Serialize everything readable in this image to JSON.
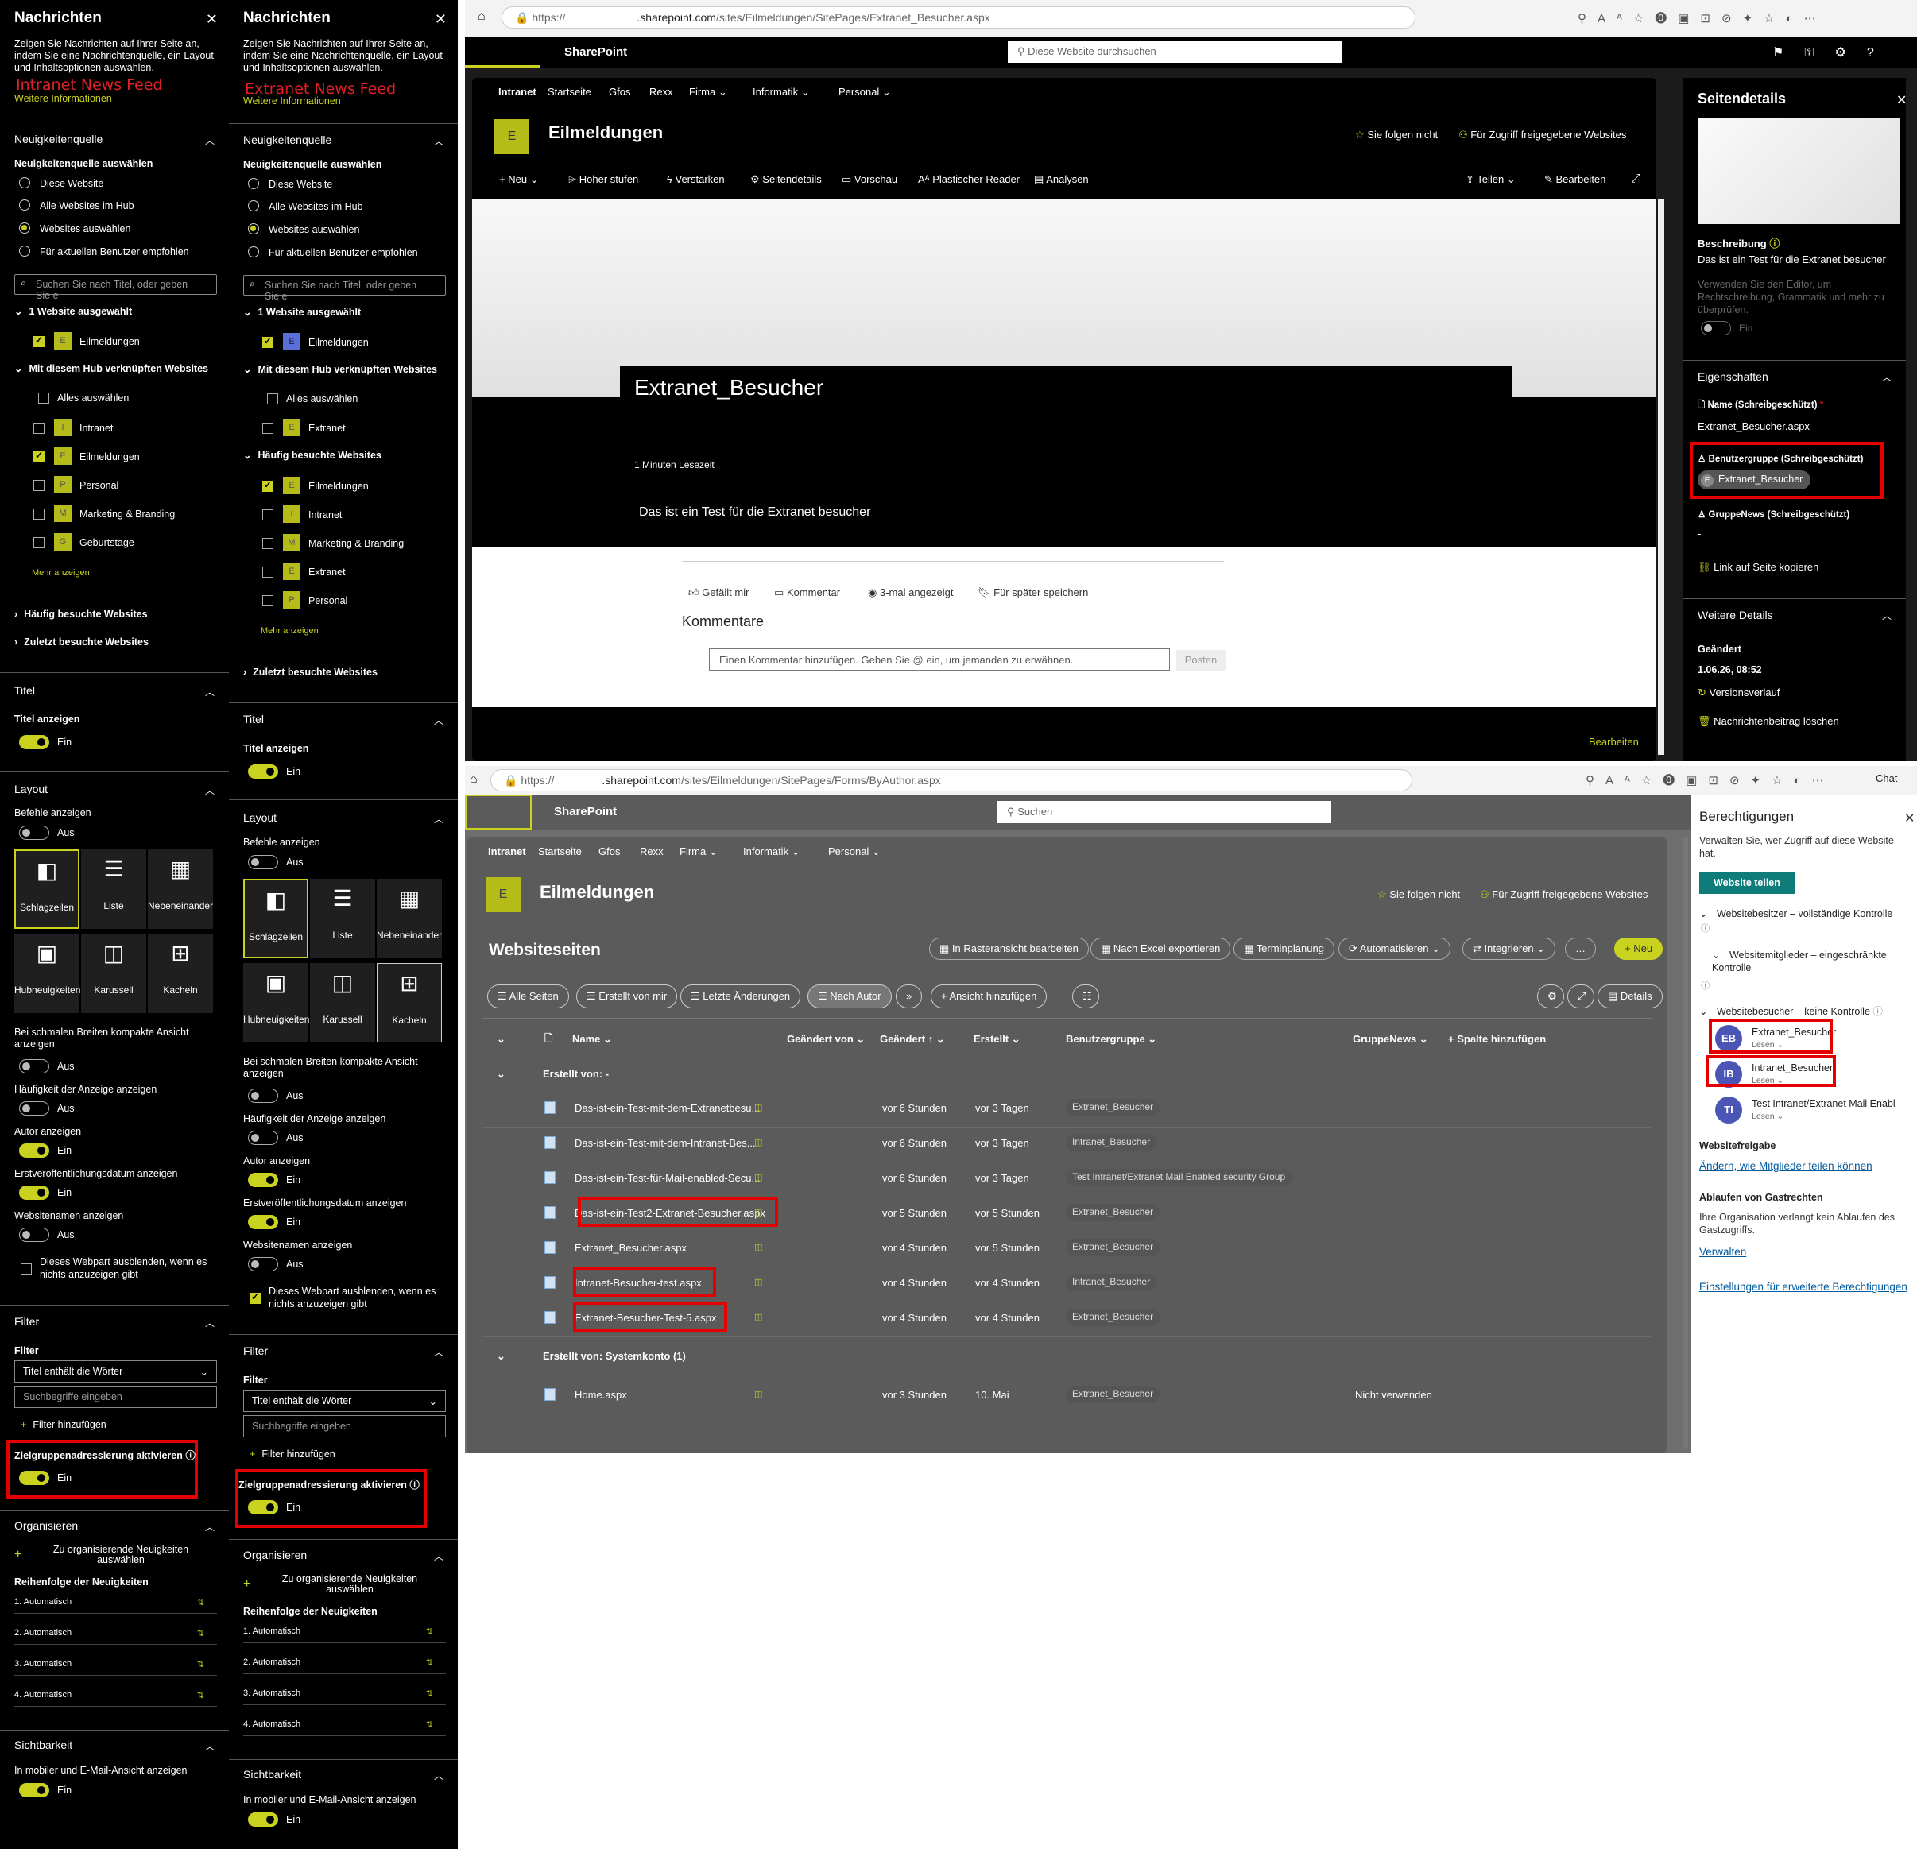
{
  "left_panes": [
    {
      "title": "Nachrichten",
      "description": "Zeigen Sie Nachrichten auf Ihrer Seite an, indem Sie eine Nachrichtenquelle, ein Layout und Inhaltsoptionen auswählen.",
      "annotation": "Intranet News Feed",
      "more_info": "Weitere Informationen",
      "source_section": "Neuigkeitenquelle",
      "source_label": "Neuigkeitenquelle auswählen",
      "radios": [
        "Diese Website",
        "Alle Websites im Hub",
        "Websites auswählen",
        "Für aktuellen Benutzer empfohlen"
      ],
      "search_placeholder": "Suchen Sie nach Titel, oder geben Sie e",
      "selected_header": "1 Website ausgewählt",
      "selected_site": "Eilmeldungen",
      "hub_header": "Mit diesem Hub verknüpften Websites",
      "select_all": "Alles auswählen",
      "hub_sites": [
        {
          "letter": "I",
          "name": "Intranet",
          "checked": false
        },
        {
          "letter": "E",
          "name": "Eilmeldungen",
          "checked": true
        },
        {
          "letter": "P",
          "name": "Personal",
          "checked": false
        },
        {
          "letter": "M",
          "name": "Marketing & Branding",
          "checked": false
        },
        {
          "letter": "G",
          "name": "Geburtstage",
          "checked": false
        }
      ],
      "more": "Mehr anzeigen",
      "frequent": "Häufig besuchte Websites",
      "recent": "Zuletzt besuchte Websites"
    },
    {
      "title": "Nachrichten",
      "description": "Zeigen Sie Nachrichten auf Ihrer Seite an, indem Sie eine Nachrichtenquelle, ein Layout und Inhaltsoptionen auswählen.",
      "annotation": "Extranet News Feed",
      "more_info": "Weitere Informationen",
      "source_section": "Neuigkeitenquelle",
      "source_label": "Neuigkeitenquelle auswählen",
      "radios": [
        "Diese Website",
        "Alle Websites im Hub",
        "Websites auswählen",
        "Für aktuellen Benutzer empfohlen"
      ],
      "search_placeholder": "Suchen Sie nach Titel, oder geben Sie e",
      "selected_header": "1 Website ausgewählt",
      "selected_site": "Eilmeldungen",
      "hub_header": "Mit diesem Hub verknüpften Websites",
      "select_all": "Alles auswählen",
      "hub_sites": [
        {
          "letter": "E",
          "name": "Extranet",
          "checked": false
        }
      ],
      "frequent": "Häufig besuchte Websites",
      "frequent_sites": [
        {
          "letter": "E",
          "name": "Eilmeldungen",
          "checked": true
        },
        {
          "letter": "I",
          "name": "Intranet",
          "checked": false
        },
        {
          "letter": "M",
          "name": "Marketing & Branding",
          "checked": false
        },
        {
          "letter": "E",
          "name": "Extranet",
          "checked": false
        },
        {
          "letter": "P",
          "name": "Personal",
          "checked": false
        }
      ],
      "more": "Mehr anzeigen",
      "recent": "Zuletzt besuchte Websites"
    }
  ],
  "pane_common": {
    "title_section": "Titel",
    "show_title": "Titel anzeigen",
    "on": "Ein",
    "off": "Aus",
    "layout_section": "Layout",
    "show_commands": "Befehle anzeigen",
    "tiles": [
      "Schlagzeilen",
      "Liste",
      "Nebeneinander",
      "Hubneuigkeiten",
      "Karussell",
      "Kacheln"
    ],
    "compact": "Bei schmalen Breiten kompakte Ansicht anzeigen",
    "views": "Häufigkeit der Anzeige anzeigen",
    "author": "Autor anzeigen",
    "first_pub": "Erstveröffentlichungsdatum anzeigen",
    "site_names": "Websitenamen anzeigen",
    "hide_webpart": "Dieses Webpart ausblenden, wenn es nichts anzuzeigen gibt",
    "filter_section": "Filter",
    "filter_label": "Filter",
    "filter_dropdown": "Titel enthält die Wörter",
    "filter_placeholder": "Suchbegriffe eingeben",
    "add_filter": "Filter hinzufügen",
    "audience": "Zielgruppenadressierung aktivieren",
    "organize_section": "Organisieren",
    "organize_pick": "Zu organisierende Neuigkeiten auswählen",
    "order_label": "Reihenfolge der Neuigkeiten",
    "order": [
      "1. Automatisch",
      "2. Automatisch",
      "3. Automatisch",
      "4. Automatisch"
    ],
    "visibility_section": "Sichtbarkeit",
    "mobile_email": "In mobiler und E-Mail-Ansicht anzeigen"
  },
  "browser_top": {
    "url_prefix": "https://",
    "url_main": ".sharepoint.com",
    "url_path": "/sites/Eilmeldungen/SitePages/Extranet_Besucher.aspx",
    "app": "SharePoint",
    "search": "Diese Website durchsuchen",
    "nav": [
      "Intranet",
      "Startseite",
      "Gfos",
      "Rexx",
      "Firma",
      "Informatik",
      "Personal"
    ],
    "site_letter": "E",
    "site_name": "Eilmeldungen",
    "follow": "Sie folgen nicht",
    "shared": "Für Zugriff freigegebene Websites",
    "commands": [
      "Neu",
      "Höher stufen",
      "Verstärken",
      "Seitendetails",
      "Vorschau",
      "Plastischer Reader",
      "Analysen"
    ],
    "share": "Teilen",
    "edit": "Bearbeiten",
    "page_title": "Extranet_Besucher",
    "read_time": "1 Minuten Lesezeit",
    "body_text": "Das ist ein Test für die Extranet besucher",
    "actions": [
      "Gefällt mir",
      "Kommentar",
      "3-mal angezeigt",
      "Für später speichern"
    ],
    "comments": "Kommentare",
    "comment_placeholder": "Einen Kommentar hinzufügen. Geben Sie @ ein, um jemanden zu erwähnen.",
    "post": "Posten",
    "footer_edit": "Bearbeiten",
    "details": {
      "title": "Seitendetails",
      "description_label": "Beschreibung",
      "description": "Das ist ein Test für die Extranet besucher",
      "hint": "Verwenden Sie den Editor, um Rechtschreibung, Grammatik und mehr zu überprüfen.",
      "hint_toggle": "Ein",
      "properties": "Eigenschaften",
      "name_label": "Name (Schreibgeschützt)",
      "name_value": "Extranet_Besucher.aspx",
      "group_label": "Benutzergruppe (Schreibgeschützt)",
      "group_value": "Extranet_Besucher",
      "group_letter": "E",
      "news_label": "GruppeNews (Schreibgeschützt)",
      "news_value": "-",
      "copy_link": "Link auf Seite kopieren",
      "more_details": "Weitere Details",
      "changed_label": "Geändert",
      "changed_value": "1.06.26, 08:52",
      "version_history": "Versionsverlauf",
      "delete": "Nachrichtenbeitrag löschen"
    }
  },
  "browser_bottom": {
    "url_prefix": "https://",
    "url_main": ".sharepoint.com",
    "url_path": "/sites/Eilmeldungen/SitePages/Forms/ByAuthor.aspx",
    "app": "SharePoint",
    "search": "Suchen",
    "chat": "Chat",
    "nav": [
      "Intranet",
      "Startseite",
      "Gfos",
      "Rexx",
      "Firma",
      "Informatik",
      "Personal"
    ],
    "site_letter": "E",
    "site_name": "Eilmeldungen",
    "follow": "Sie folgen nicht",
    "shared": "Für Zugriff freigegebene Websites",
    "lib_title": "Websiteseiten",
    "toolbar": [
      "In Rasteransicht bearbeiten",
      "Nach Excel exportieren",
      "Terminplanung",
      "Automatisieren",
      "Integrieren",
      "…",
      "Neu"
    ],
    "views": [
      "Alle Seiten",
      "Erstellt von mir",
      "Letzte Änderungen",
      "Nach Autor",
      "»",
      "Ansicht hinzufügen"
    ],
    "details_btn": "Details",
    "columns": [
      "Name",
      "Geändert von",
      "Geändert",
      "Erstellt",
      "Benutzergruppe",
      "GruppeNews",
      "Spalte hinzufügen"
    ],
    "group1": "Erstellt von: -",
    "rows1": [
      {
        "name": "Das-ist-ein-Test-mit-dem-Extranetbesu...",
        "changed": "vor 6 Stunden",
        "created": "vor 3 Tagen",
        "group": "Extranet_Besucher",
        "news": ""
      },
      {
        "name": "Das-ist-ein-Test-mit-dem-Intranet-Bes...",
        "changed": "vor 6 Stunden",
        "created": "vor 3 Tagen",
        "group": "Intranet_Besucher",
        "news": ""
      },
      {
        "name": "Das-ist-ein-Test-für-Mail-enabled-Secu...",
        "changed": "vor 6 Stunden",
        "created": "vor 3 Tagen",
        "group": "Test Intranet/Extranet Mail Enabled security Group",
        "news": ""
      },
      {
        "name": "Das-ist-ein-Test2-Extranet-Besucher.aspx",
        "changed": "vor 5 Stunden",
        "created": "vor 5 Stunden",
        "group": "Extranet_Besucher",
        "news": ""
      },
      {
        "name": "Extranet_Besucher.aspx",
        "changed": "vor 4 Stunden",
        "created": "vor 5 Stunden",
        "group": "Extranet_Besucher",
        "news": ""
      },
      {
        "name": "Intranet-Besucher-test.aspx",
        "changed": "vor 4 Stunden",
        "created": "vor 4 Stunden",
        "group": "Intranet_Besucher",
        "news": ""
      },
      {
        "name": "Extranet-Besucher-Test-5.aspx",
        "changed": "vor 4 Stunden",
        "created": "vor 4 Stunden",
        "group": "Extranet_Besucher",
        "news": ""
      }
    ],
    "group2": "Erstellt von: Systemkonto (1)",
    "rows2": [
      {
        "name": "Home.aspx",
        "changed": "vor 3 Stunden",
        "created": "10. Mai",
        "group": "Extranet_Besucher",
        "news": "Nicht verwenden"
      }
    ],
    "permissions": {
      "title": "Berechtigungen",
      "desc": "Verwalten Sie, wer Zugriff auf diese Website hat.",
      "share_btn": "Website teilen",
      "owners": "Websitebesitzer – vollständige Kontrolle",
      "members": "Websitemitglieder – eingeschränkte Kontrolle",
      "visitors": "Websitebesucher – keine Kontrolle",
      "people": [
        {
          "initials": "EB",
          "name": "Extranet_Besucher",
          "role": "Lesen"
        },
        {
          "initials": "IB",
          "name": "Intranet_Besucher",
          "role": "Lesen"
        },
        {
          "initials": "TI",
          "name": "Test Intranet/Extranet Mail Enabl",
          "role": "Lesen"
        }
      ],
      "sharing": "Websitefreigabe",
      "sharing_link": "Ändern, wie Mitglieder teilen können",
      "guest": "Ablaufen von Gastrechten",
      "guest_desc": "Ihre Organisation verlangt kein Ablaufen des Gastzugriffs.",
      "manage": "Verwalten",
      "advanced": "Einstellungen für erweiterte Berechtigungen"
    }
  },
  "colors": {
    "accent": "#c9d21f",
    "highlight": "#e20000",
    "teal": "#107c7a"
  }
}
